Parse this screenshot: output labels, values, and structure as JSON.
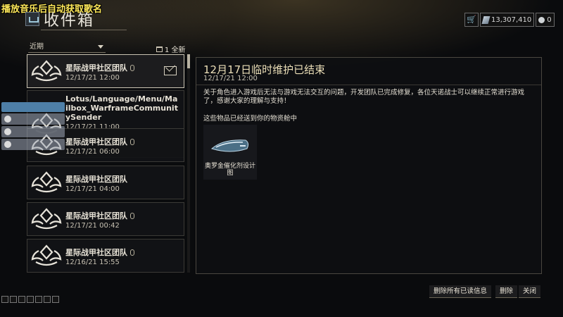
{
  "overlay": {
    "title": "播放音乐后自动获取歌名"
  },
  "header": {
    "title": "收件箱"
  },
  "currency": {
    "platinum": "13,307,410",
    "credits": "0"
  },
  "filter": {
    "sort": "近期",
    "count": "1 全新"
  },
  "messages": [
    {
      "sender": "星际战甲社区团队",
      "date": "12/17/21 12:00",
      "attachment": true,
      "selected": true,
      "unread": true
    },
    {
      "sender": "Lotus/Language/Menu/Mailbox_WarframeCommunitySender",
      "date": "12/17/21 11:00",
      "attachment": false
    },
    {
      "sender": "星际战甲社区团队",
      "date": "12/17/21 06:00",
      "attachment": true
    },
    {
      "sender": "星际战甲社区团队",
      "date": "12/17/21 04:00",
      "attachment": false
    },
    {
      "sender": "星际战甲社区团队",
      "date": "12/17/21 00:42",
      "attachment": true
    },
    {
      "sender": "星际战甲社区团队",
      "date": "12/16/21 15:55",
      "attachment": true
    }
  ],
  "detail": {
    "title": "12月17日临时维护已结束",
    "date": "12/17/21 12:00",
    "body": "关于角色进入游戏后无法与游戏无法交互的问题，开发团队已完成修复，各位天诺战士可以继续正常进行游戏了，感谢大家的理解与支持！",
    "items_heading": "这些物品已经送到你的物资舱中",
    "item_name": "奥罗金催化剂设计图"
  },
  "actions": {
    "delete_read": "删除所有已读信息",
    "delete": "删除",
    "close": "关闭"
  },
  "icons": {
    "lotus": "lotus-emblem-icon",
    "paperclip": "paperclip-icon",
    "envelope": "envelope-icon",
    "cart": "cart-icon"
  }
}
